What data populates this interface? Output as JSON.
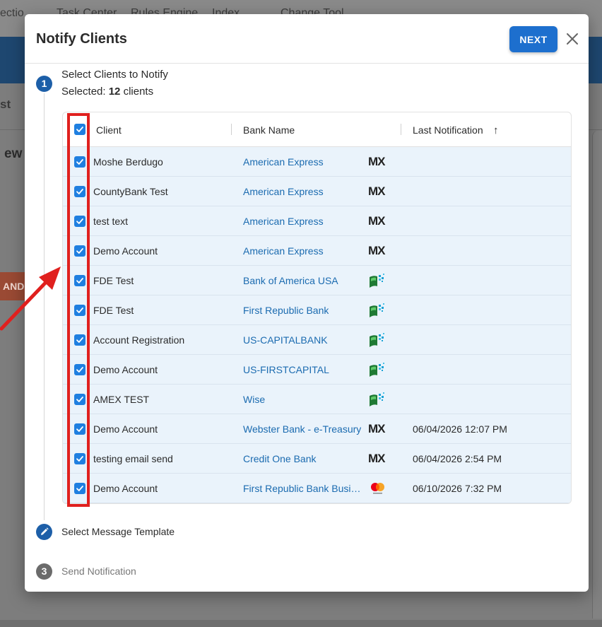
{
  "background": {
    "topbar_texts": [
      "ectio",
      "Task Center",
      "Rules Engine",
      "Index",
      "Change Tool"
    ],
    "tab_text": "st",
    "heading_text": "ew",
    "orange_button_text": "AND"
  },
  "modal": {
    "title": "Notify Clients",
    "next_label": "NEXT",
    "close_glyph": "✕"
  },
  "steps": [
    {
      "number": "1",
      "label": "Select Clients to Notify",
      "state": "active"
    },
    {
      "number": "",
      "label": "Select Message Template",
      "state": "edit",
      "icon": "pencil-icon"
    },
    {
      "number": "3",
      "label": "Send Notification",
      "state": "inactive"
    }
  ],
  "selection": {
    "prefix": "Selected:",
    "count": "12",
    "suffix": "clients"
  },
  "table": {
    "columns": {
      "client": "Client",
      "bank": "Bank Name",
      "last_notification": "Last Notification",
      "sort_arrow": "↑"
    },
    "rows": [
      {
        "client": "Moshe Berdugo",
        "bank": "American Express",
        "provider": "MX",
        "date": "",
        "checked": true
      },
      {
        "client": "CountyBank Test",
        "bank": "American Express",
        "provider": "MX",
        "date": "",
        "checked": true
      },
      {
        "client": "test text",
        "bank": "American Express",
        "provider": "MX",
        "date": "",
        "checked": true
      },
      {
        "client": "Demo Account",
        "bank": "American Express",
        "provider": "MX",
        "date": "",
        "checked": true
      },
      {
        "client": "FDE Test",
        "bank": "Bank of America USA",
        "provider": "finicity",
        "date": "",
        "checked": true
      },
      {
        "client": "FDE Test",
        "bank": "First Republic Bank",
        "provider": "finicity",
        "date": "",
        "checked": true
      },
      {
        "client": "Account Registration",
        "bank": "US-CAPITALBANK",
        "provider": "finicity",
        "date": "",
        "checked": true
      },
      {
        "client": "Demo Account",
        "bank": "US-FIRSTCAPITAL",
        "provider": "finicity",
        "date": "",
        "checked": true
      },
      {
        "client": "AMEX TEST",
        "bank": "Wise",
        "provider": "finicity",
        "date": "",
        "checked": true
      },
      {
        "client": "Demo Account",
        "bank": "Webster Bank - e-Treasury",
        "provider": "MX",
        "date": "06/04/2026 12:07 PM",
        "checked": true
      },
      {
        "client": "testing email send",
        "bank": "Credit One Bank",
        "provider": "MX",
        "date": "06/04/2026 2:54 PM",
        "checked": true
      },
      {
        "client": "Demo Account",
        "bank": "First Republic Bank Busin...",
        "provider": "mastercard",
        "date": "06/10/2026 7:32 PM",
        "checked": true
      }
    ]
  },
  "colors": {
    "primary": "#1d6fce",
    "checkbox": "#1f7fe0",
    "row_bg": "#eaf3fb",
    "annotation_red": "#e0201e",
    "link": "#1b6bb0"
  }
}
